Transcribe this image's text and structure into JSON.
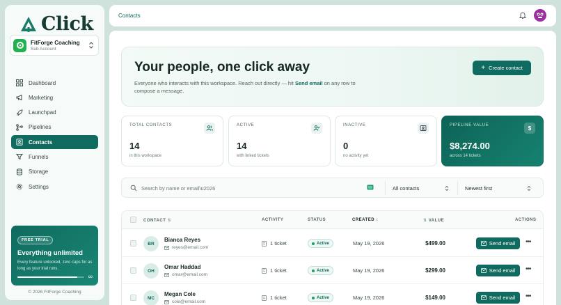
{
  "brand": {
    "name": "Click",
    "color": "#0f6b5f"
  },
  "account": {
    "name": "FitForge Coaching",
    "sub": "Sub Account"
  },
  "nav": [
    {
      "label": "Dashboard",
      "icon": "grid-icon",
      "active": false
    },
    {
      "label": "Marketing",
      "icon": "megaphone-icon",
      "active": false
    },
    {
      "label": "Launchpad",
      "icon": "rocket-icon",
      "active": false
    },
    {
      "label": "Pipelines",
      "icon": "pipeline-icon",
      "active": false
    },
    {
      "label": "Contacts",
      "icon": "contacts-icon",
      "active": true
    },
    {
      "label": "Funnels",
      "icon": "funnel-icon",
      "active": false
    },
    {
      "label": "Storage",
      "icon": "database-icon",
      "active": false
    },
    {
      "label": "Settings",
      "icon": "gear-icon",
      "active": false
    }
  ],
  "trial": {
    "badge": "FREE TRIAL",
    "title": "Everything unlimited",
    "desc": "Every feature unlocked, zero caps for as long as your trial runs.",
    "progress": 0.9,
    "infinity": "∞"
  },
  "copyright": "© 2026 FitForge Coaching",
  "topbar": {
    "breadcrumb": "Contacts"
  },
  "hero": {
    "title": "Your people, one click away",
    "desc_pre": "Everyone who interacts with this workspace. Reach out directly — hit ",
    "desc_link": "Send email",
    "desc_post": " on any row to compose a message.",
    "cta": "Create contact"
  },
  "stats": [
    {
      "label": "TOTAL CONTACTS",
      "value": "14",
      "sub": "in this workspace",
      "icon": "users-icon"
    },
    {
      "label": "ACTIVE",
      "value": "14",
      "sub": "with linked tickets",
      "icon": "user-check-icon"
    },
    {
      "label": "INACTIVE",
      "value": "0",
      "sub": "no activity yet",
      "icon": "id-card-icon"
    },
    {
      "label": "PIPELINE VALUE",
      "value": "$8,274.00",
      "sub": "across 14 tickets",
      "icon": "dollar-icon"
    }
  ],
  "filters": {
    "search_placeholder": "Search by name or email\\u2026",
    "status_selected": "All contacts",
    "sort_selected": "Newest first"
  },
  "table": {
    "headers": {
      "contact": "CONTACT",
      "activity": "ACTIVITY",
      "status": "STATUS",
      "created": "CREATED",
      "value": "VALUE",
      "actions": "ACTIONS"
    },
    "rows": [
      {
        "initials": "BR",
        "name": "Bianca Reyes",
        "email": "reyes@email.com",
        "activity": "1 ticket",
        "status": "Active",
        "created": "May 19, 2026",
        "value": "$499.00",
        "action": "Send email"
      },
      {
        "initials": "OH",
        "name": "Omar Haddad",
        "email": "omar@email.com",
        "activity": "1 ticket",
        "status": "Active",
        "created": "May 19, 2026",
        "value": "$299.00",
        "action": "Send email"
      },
      {
        "initials": "MC",
        "name": "Megan Cole",
        "email": "cole@email.com",
        "activity": "1 ticket",
        "status": "Active",
        "created": "May 19, 2026",
        "value": "$149.00",
        "action": "Send email"
      }
    ]
  }
}
